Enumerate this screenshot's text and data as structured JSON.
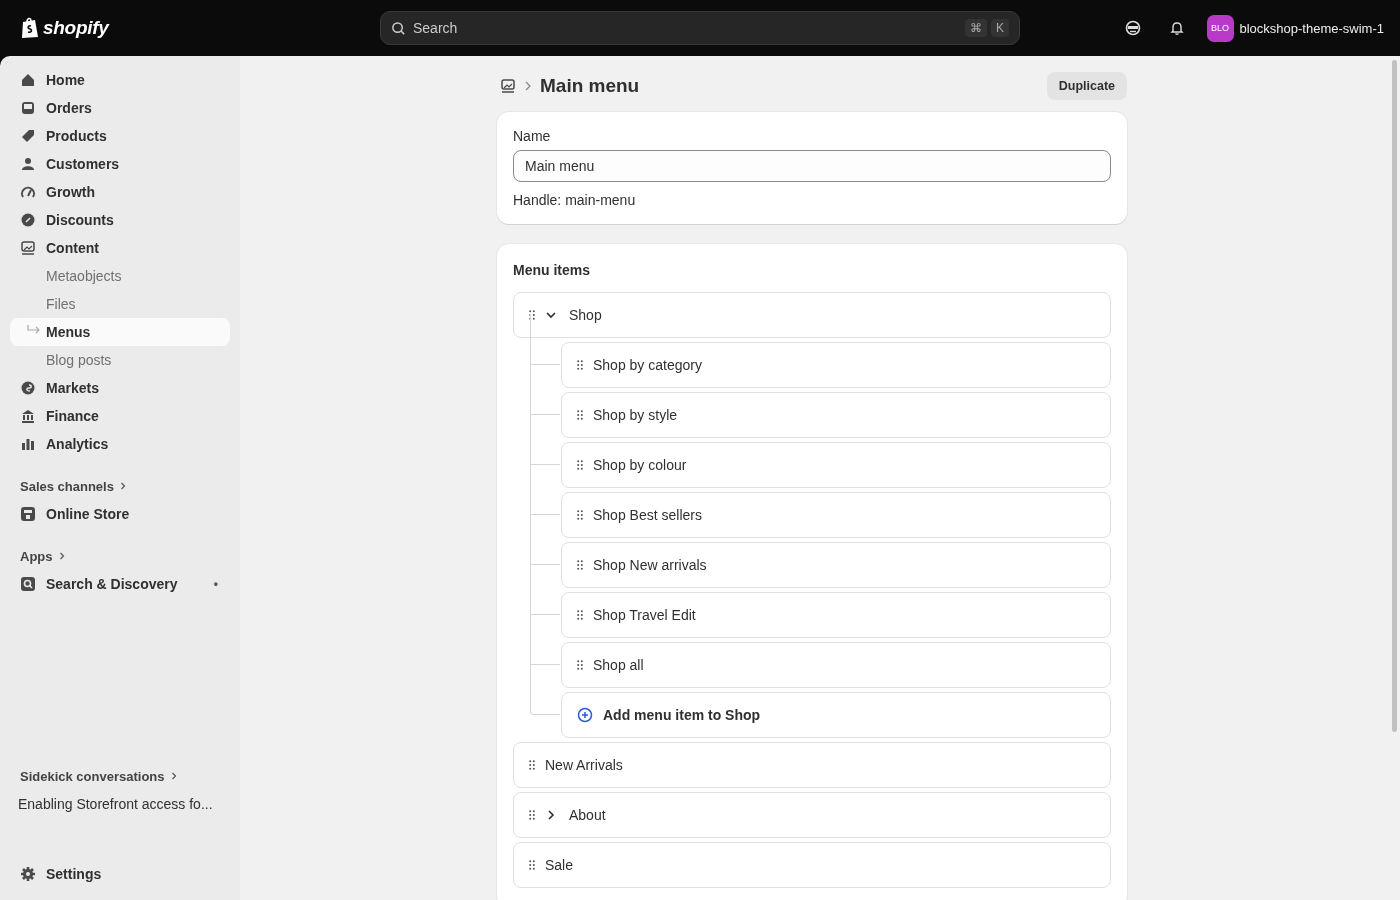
{
  "topbar": {
    "brand": "shopify",
    "search": {
      "placeholder": "Search",
      "keys": [
        "⌘",
        "K"
      ]
    },
    "store": {
      "avatar": "BLO",
      "name": "blockshop-theme-swim-1"
    }
  },
  "sidebar": {
    "items": [
      {
        "label": "Home",
        "selected": false
      },
      {
        "label": "Orders",
        "selected": false
      },
      {
        "label": "Products",
        "selected": false
      },
      {
        "label": "Customers",
        "selected": false
      },
      {
        "label": "Growth",
        "selected": false
      },
      {
        "label": "Discounts",
        "selected": false
      },
      {
        "label": "Content",
        "selected": false,
        "children": [
          {
            "label": "Metaobjects",
            "selected": false
          },
          {
            "label": "Files",
            "selected": false
          },
          {
            "label": "Menus",
            "selected": true
          },
          {
            "label": "Blog posts",
            "selected": false
          }
        ]
      },
      {
        "label": "Markets",
        "selected": false
      },
      {
        "label": "Finance",
        "selected": false
      },
      {
        "label": "Analytics",
        "selected": false
      }
    ],
    "sales_channels": {
      "heading": "Sales channels",
      "items": [
        {
          "label": "Online Store",
          "selected": false
        }
      ]
    },
    "apps": {
      "heading": "Apps",
      "items": [
        {
          "label": "Search & Discovery",
          "selected": false,
          "dot": "•"
        }
      ]
    },
    "sidekick": {
      "heading": "Sidekick conversations",
      "items": [
        "Enabling Storefront access fo..."
      ]
    },
    "settings": {
      "label": "Settings",
      "selected": false
    }
  },
  "page": {
    "title": "Main menu",
    "action": "Duplicate",
    "name_card": {
      "label": "Name",
      "value": "Main menu",
      "handle": "Handle: main-menu"
    },
    "menu_items": {
      "heading": "Menu items",
      "items": [
        {
          "label": "Shop",
          "expanded": true,
          "children": [
            {
              "label": "Shop by category"
            },
            {
              "label": "Shop by style"
            },
            {
              "label": "Shop by colour"
            },
            {
              "label": "Shop Best sellers"
            },
            {
              "label": "Shop New arrivals"
            },
            {
              "label": "Shop Travel Edit"
            },
            {
              "label": "Shop all"
            }
          ],
          "add_label": "Add menu item to Shop"
        },
        {
          "label": "New Arrivals"
        },
        {
          "label": "About",
          "expanded": false
        },
        {
          "label": "Sale"
        }
      ]
    }
  }
}
